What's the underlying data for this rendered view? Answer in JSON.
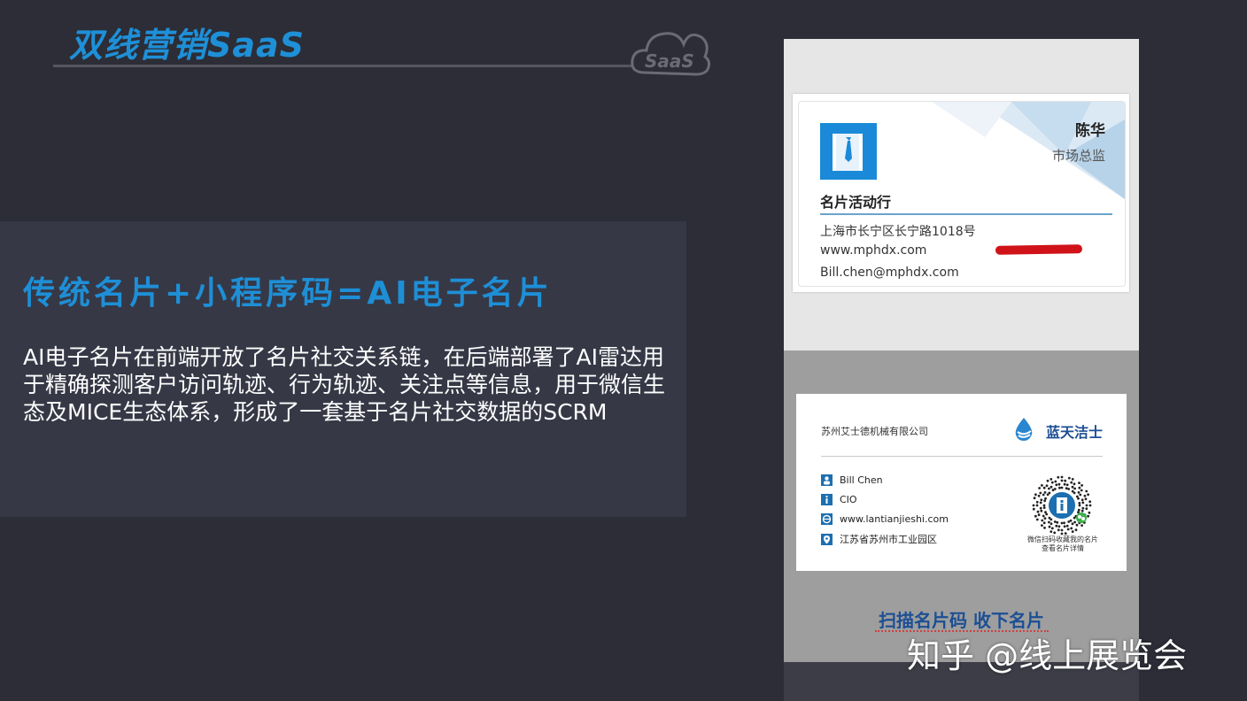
{
  "header": {
    "title": "双线营销SaaS",
    "badge": "SaaS"
  },
  "panel": {
    "heading": "传统名片+小程序码=AI电子名片",
    "body": "AI电子名片在前端开放了名片社交关系链，在后端部署了AI雷达用于精确探测客户访问轨迹、行为轨迹、关注点等信息，用于微信生态及MICE生态体系，形成了一套基于名片社交数据的SCRM"
  },
  "card1": {
    "name": "陈华",
    "title": "市场总监",
    "company": "名片活动行",
    "address": "上海市长宁区长宁路1018号",
    "website": "www.mphdx.com",
    "email": "Bill.chen@mphdx.com"
  },
  "card2": {
    "company": "苏州艾士德机械有限公司",
    "brand": "蓝天洁士",
    "rows": [
      {
        "text": "Bill Chen",
        "icon": "person-icon"
      },
      {
        "text": "CIO",
        "icon": "info-icon"
      },
      {
        "text": "www.lantianjieshi.com",
        "icon": "globe-icon"
      },
      {
        "text": "江苏省苏州市工业园区",
        "icon": "location-icon"
      }
    ],
    "qr_caption_1": "微信扫码收藏我的名片",
    "qr_caption_2": "查看名片详情"
  },
  "slogan": "扫描名片码 收下名片",
  "watermark": "知乎 @线上展览会",
  "colors": {
    "background": "#2c2d37",
    "panel": "#363846",
    "accent": "#1e8fd6",
    "brand_blue": "#1c4f94"
  }
}
